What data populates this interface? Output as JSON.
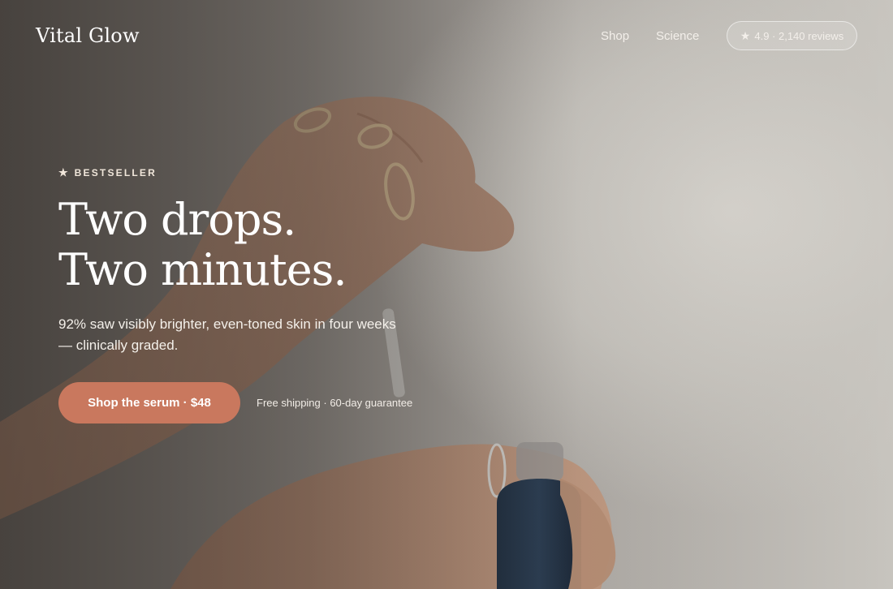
{
  "brand": {
    "name": "Vital Glow"
  },
  "nav": {
    "items": [
      {
        "label": "Shop"
      },
      {
        "label": "Science"
      }
    ],
    "rating": {
      "icon": "star-icon",
      "text": "4.9 · 2,140 reviews"
    }
  },
  "hero": {
    "badge": {
      "icon": "star-icon",
      "label": "BESTSELLER"
    },
    "headline": [
      "Two drops.",
      "Two minutes."
    ],
    "subcopy": "92% saw visibly brighter, even-toned skin in four weeks — clinically graded.",
    "cta_label": "Shop the serum · $48",
    "assurance": "Free shipping · 60-day guarantee",
    "image": {
      "icon": "serum-dropper-photo"
    }
  },
  "colors": {
    "cta": "#c9785e",
    "badge_text": "#f0e6da",
    "background": "#c7c4be"
  }
}
